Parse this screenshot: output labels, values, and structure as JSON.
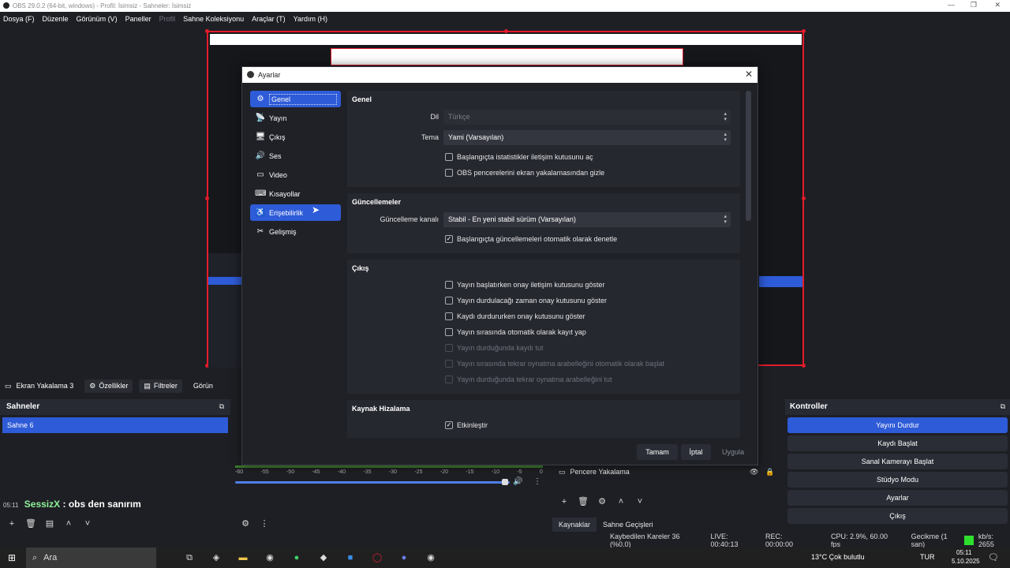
{
  "window": {
    "title": "OBS 29.0.2 (64-bit, windows) - Profil: İsimsiz - Sahneler: İsimsiz"
  },
  "menu": [
    {
      "label": "Dosya (F)",
      "dim": false
    },
    {
      "label": "Düzenle",
      "dim": false
    },
    {
      "label": "Görünüm (V)",
      "dim": false
    },
    {
      "label": "Paneller",
      "dim": false
    },
    {
      "label": "Profil",
      "dim": true
    },
    {
      "label": "Sahne Koleksiyonu",
      "dim": false
    },
    {
      "label": "Araçlar (T)",
      "dim": false
    },
    {
      "label": "Yardım (H)",
      "dim": false
    }
  ],
  "source_bar": {
    "source": "Ekran Yakalama 3",
    "properties": "Özellikler",
    "filters": "Filtreler",
    "more": "Görün"
  },
  "scenes": {
    "title": "Sahneler",
    "selected": "Sahne 6"
  },
  "chat": {
    "time": "05:11",
    "name": "SessizX",
    "message": ": obs den sanırım"
  },
  "mixer": {
    "ticks": [
      "-60",
      "-55",
      "-50",
      "-45",
      "-40",
      "-35",
      "-30",
      "-25",
      "-20",
      "-15",
      "-10",
      "-5",
      "0"
    ]
  },
  "sources": {
    "item": "Pencere Yakalama",
    "tab_sources": "Kaynaklar",
    "tab_transitions": "Sahne Geçişleri"
  },
  "controls": {
    "title": "Kontroller",
    "buttons": [
      "Yayını Durdur",
      "Kaydı Başlat",
      "Sanal Kamerayı Başlat",
      "Stüdyo Modu",
      "Ayarlar",
      "Çıkış"
    ]
  },
  "status": {
    "dropped": "Kaybedilen Kareler 36 (%0.0)",
    "live": "LIVE: 00:40:13",
    "rec": "REC: 00:00:00",
    "cpu": "CPU: 2.9%, 60.00 fps",
    "delay": "Gecikme (1 san)",
    "kbs": "kb/s: 2655"
  },
  "taskbar": {
    "search": "Ara",
    "weather": "13°C  Çok bulutlu",
    "lang": "TUR",
    "time": "05:11",
    "date": "5.10.2025"
  },
  "dialog": {
    "title": "Ayarlar",
    "nav": [
      {
        "label": "Genel",
        "icon": "gear-icon",
        "glyph": "⚙"
      },
      {
        "label": "Yayın",
        "icon": "antenna-icon",
        "glyph": "📡"
      },
      {
        "label": "Çıkış",
        "icon": "output-icon",
        "glyph": "🖥"
      },
      {
        "label": "Ses",
        "icon": "speaker-icon",
        "glyph": "🔊"
      },
      {
        "label": "Video",
        "icon": "monitor-icon",
        "glyph": "▭"
      },
      {
        "label": "Kısayollar",
        "icon": "keyboard-icon",
        "glyph": "⌨"
      },
      {
        "label": "Erişebilirlik",
        "icon": "accessibility-icon",
        "glyph": "♿"
      },
      {
        "label": "Gelişmiş",
        "icon": "tools-icon",
        "glyph": "✂"
      }
    ],
    "general": {
      "title": "Genel",
      "lang_label": "Dil",
      "lang_value": "Türkçe",
      "theme_label": "Tema",
      "theme_value": "Yami (Varsayılan)",
      "cb_stats": "Başlangıçta istatistikler iletişim kutusunu aç",
      "cb_hide": "OBS pencerelerini ekran yakalamasından gizle"
    },
    "updates": {
      "title": "Güncellemeler",
      "channel_label": "Güncelleme kanalı",
      "channel_value": "Stabil - En yeni stabil sürüm (Varsayılan)",
      "cb_check": "Başlangıçta güncellemeleri otomatik olarak denetle"
    },
    "output": {
      "title": "Çıkış",
      "items": [
        {
          "label": "Yayın başlatırken onay iletişim kutusunu göster",
          "checked": false,
          "disabled": false
        },
        {
          "label": "Yayın durdulacağı zaman onay kutusunu göster",
          "checked": false,
          "disabled": false
        },
        {
          "label": "Kaydı durdururken onay kutusunu göster",
          "checked": false,
          "disabled": false
        },
        {
          "label": "Yayın sırasında otomatik olarak kayıt yap",
          "checked": false,
          "disabled": false
        },
        {
          "label": "Yayın durduğunda kaydı tut",
          "checked": false,
          "disabled": true
        },
        {
          "label": "Yayın sırasında tekrar oynatma arabelleğini otomatik olarak başlat",
          "checked": false,
          "disabled": true
        },
        {
          "label": "Yayın durduğunda tekrar oynatma arabelleğini tut",
          "checked": false,
          "disabled": true
        }
      ]
    },
    "snap": {
      "title": "Kaynak Hizalama",
      "cb_enable": "Etkinleştir"
    },
    "buttons": {
      "ok": "Tamam",
      "cancel": "İptal",
      "apply": "Uygula"
    }
  }
}
